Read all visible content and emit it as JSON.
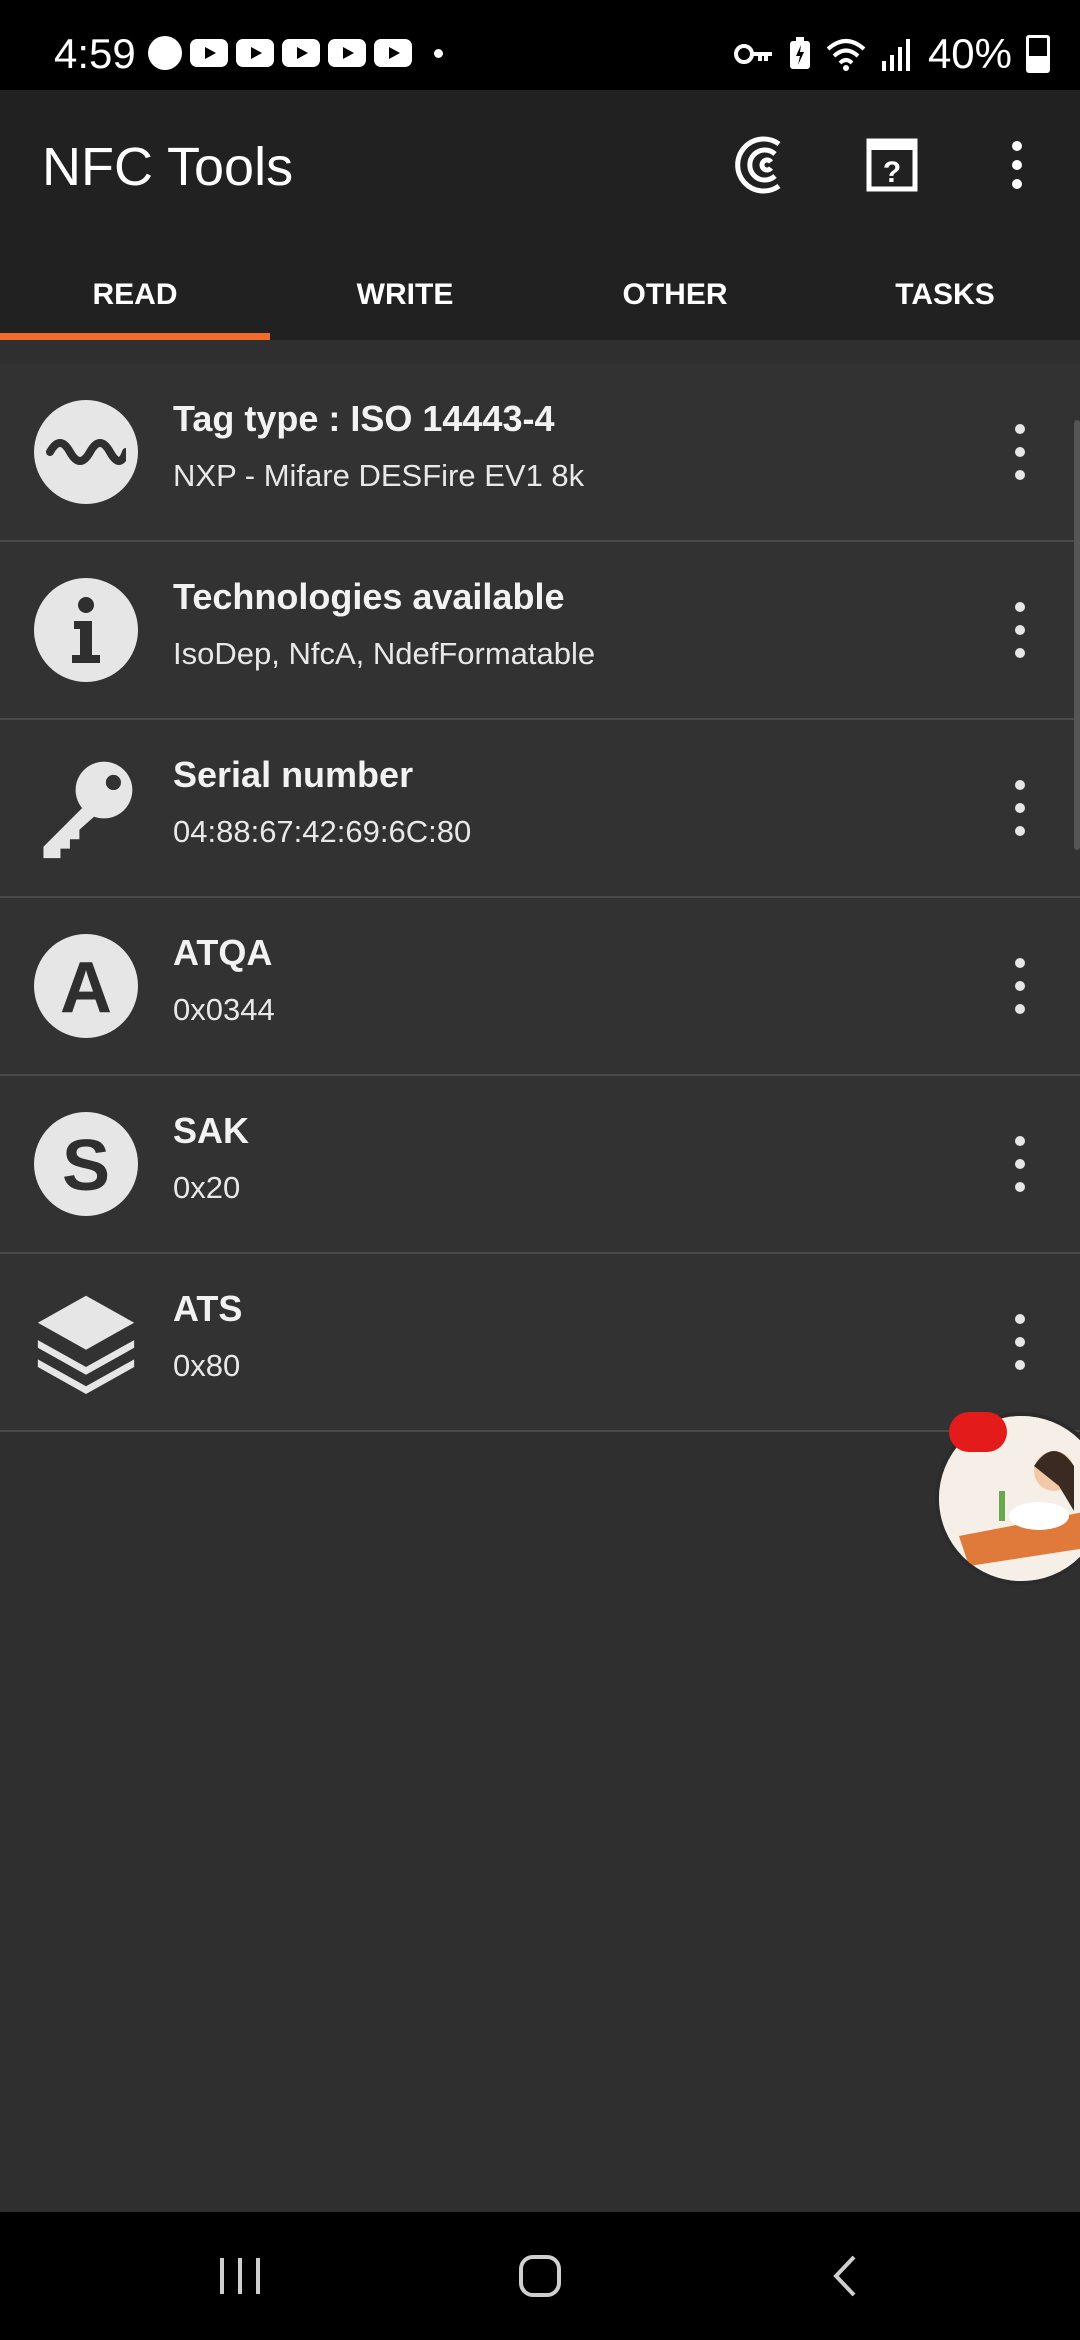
{
  "status_bar": {
    "time": "4:59",
    "battery": "40%",
    "icons": [
      "messenger-icon",
      "youtube-icon",
      "youtube-icon",
      "youtube-icon",
      "youtube-icon",
      "youtube-icon",
      "dot-icon",
      "vpn-key-icon",
      "battery-saver-icon",
      "wifi-icon",
      "signal-icon",
      "battery-icon"
    ]
  },
  "app_bar": {
    "title": "NFC Tools",
    "actions": [
      "nfc-scan-icon",
      "help-book-icon",
      "overflow-menu-icon"
    ]
  },
  "tabs": [
    {
      "label": "READ",
      "active": true
    },
    {
      "label": "WRITE",
      "active": false
    },
    {
      "label": "OTHER",
      "active": false
    },
    {
      "label": "TASKS",
      "active": false
    }
  ],
  "colors": {
    "accent": "#f26b2a",
    "background": "#2f2f2f",
    "app_bar": "#212121",
    "icon_circle": "#e6e6e6",
    "badge": "#e31b1b"
  },
  "items": [
    {
      "icon": "wave-icon",
      "title": "Tag type : ISO 14443-4",
      "subtitle": "NXP - Mifare DESFire EV1 8k"
    },
    {
      "icon": "info-icon",
      "title": "Technologies available",
      "subtitle": "IsoDep, NfcA, NdefFormatable"
    },
    {
      "icon": "key-icon",
      "title": "Serial number",
      "subtitle": "04:88:67:42:69:6C:80"
    },
    {
      "icon": "letter-a-icon",
      "title": "ATQA",
      "subtitle": "0x0344"
    },
    {
      "icon": "letter-s-icon",
      "title": "SAK",
      "subtitle": "0x20"
    },
    {
      "icon": "layers-icon",
      "title": "ATS",
      "subtitle": "0x80"
    }
  ],
  "chat_head": {
    "icon": "avatar-bitmoji-icon",
    "badge_icon": "notification-badge-icon"
  },
  "nav_bar": [
    "recents-icon",
    "home-icon",
    "back-icon"
  ]
}
